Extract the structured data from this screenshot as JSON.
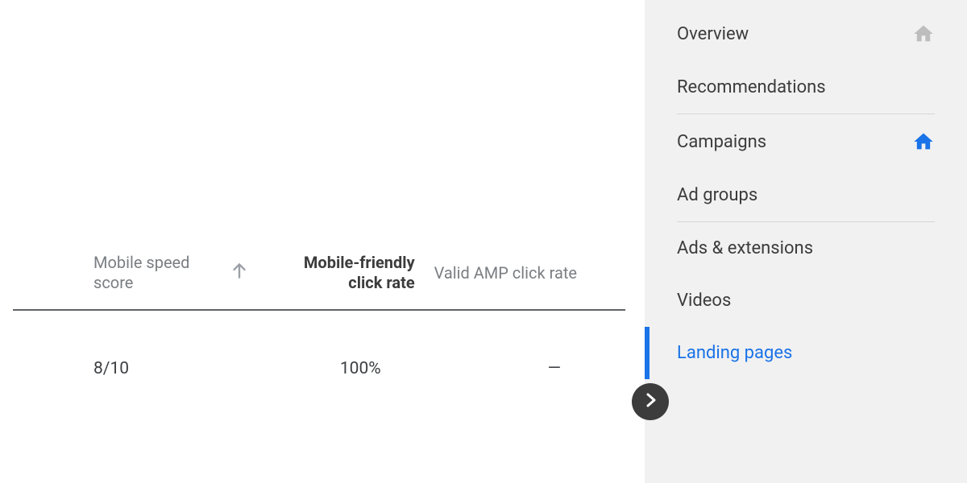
{
  "table": {
    "headers": {
      "speed": "Mobile speed score",
      "mfcr": "Mobile-friendly click rate",
      "amp": "Valid AMP click rate"
    },
    "rows": [
      {
        "speed": "8/10",
        "mfcr": "100%",
        "amp": "—"
      }
    ]
  },
  "sidebar": {
    "items": [
      {
        "label": "Overview",
        "icon": "home",
        "iconColor": "gray"
      },
      {
        "label": "Recommendations"
      },
      {
        "divider": true
      },
      {
        "label": "Campaigns",
        "icon": "home",
        "iconColor": "blue"
      },
      {
        "label": "Ad groups"
      },
      {
        "divider": true
      },
      {
        "label": "Ads & extensions"
      },
      {
        "label": "Videos"
      },
      {
        "label": "Landing pages",
        "selected": true
      }
    ]
  }
}
